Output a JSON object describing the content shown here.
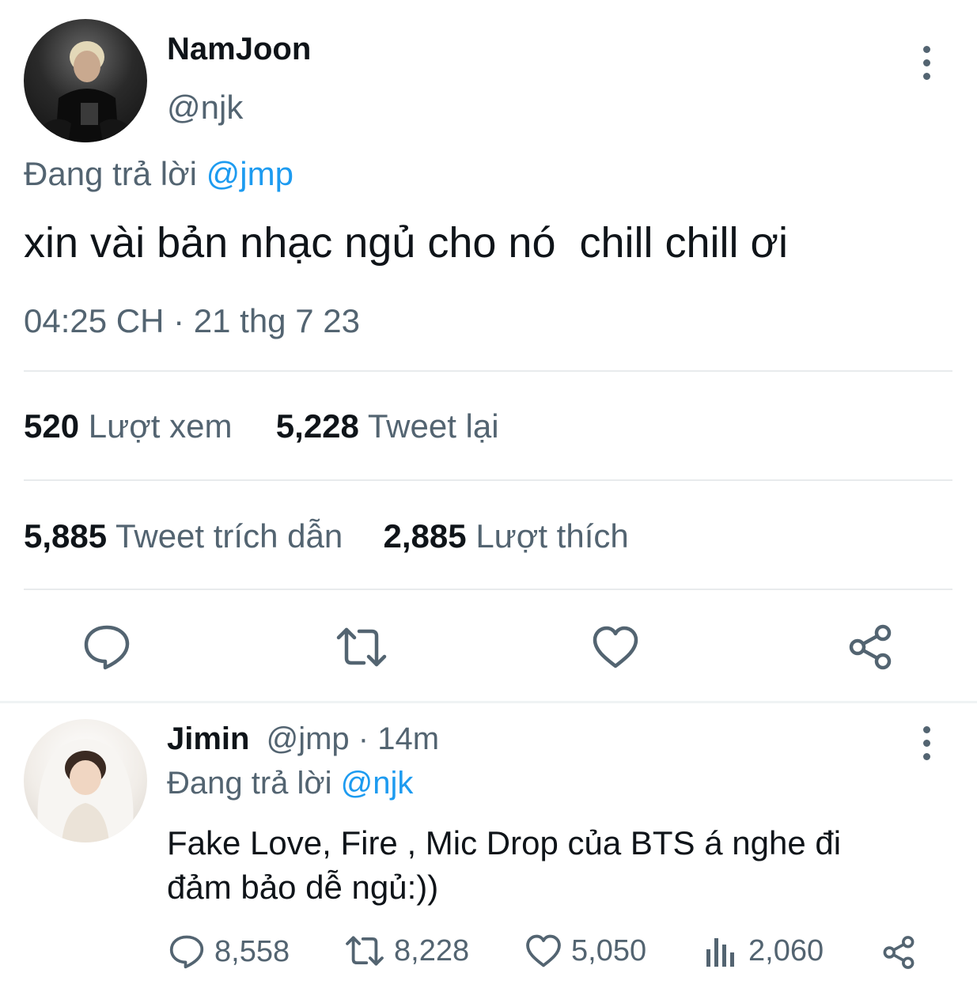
{
  "main_tweet": {
    "author_name": "NamJoon",
    "author_handle": "@njk",
    "replying_label": "Đang trả lời",
    "replying_to": "@jmp",
    "text": "xin vài bản nhạc ngủ cho nó  chill chill ơi",
    "timestamp": "04:25 CH · 21 thg 7 23",
    "stats": {
      "views_count": "520",
      "views_label": "Lượt xem",
      "retweets_count": "5,228",
      "retweets_label": "Tweet lại",
      "quotes_count": "5,885",
      "quotes_label": "Tweet trích dẫn",
      "likes_count": "2,885",
      "likes_label": "Lượt thích"
    },
    "actions": [
      "reply-icon",
      "retweet-icon",
      "like-icon",
      "share-icon"
    ]
  },
  "reply_tweet": {
    "author_name": "Jimin",
    "author_handle": "@jmp",
    "time_ago": "· 14m",
    "replying_label": "Đang trả lời",
    "replying_to": "@njk",
    "text_line1": "Fake Love, Fire , Mic Drop của BTS á nghe đi",
    "text_line2": "đảm bảo dễ ngủ:))",
    "reply_count": "8,558",
    "retweet_count": "8,228",
    "like_count": "5,050",
    "views_count": "2,060"
  },
  "colors": {
    "text": "#0f1419",
    "muted": "#536471",
    "link": "#1d9bf0",
    "divider": "#e8ebed"
  }
}
